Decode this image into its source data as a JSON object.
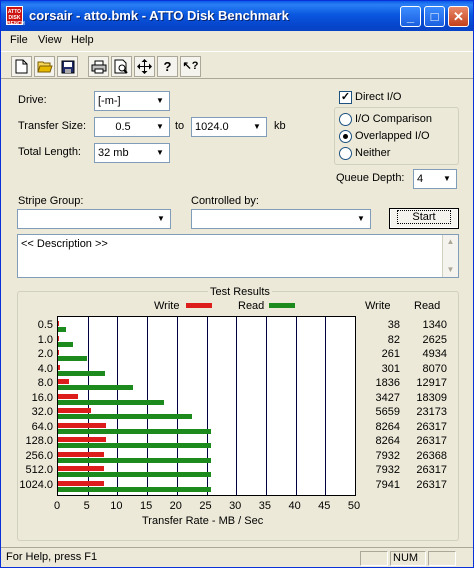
{
  "window": {
    "title": "corsair - atto.bmk - ATTO Disk Benchmark",
    "app_icon_text": "ATTO DISK BENCH"
  },
  "titlebar_buttons": {
    "minimize": "_",
    "maximize": "□",
    "close": "✕"
  },
  "menu": [
    "File",
    "View",
    "Help"
  ],
  "toolbar_icons": [
    "new-file-icon",
    "open-folder-icon",
    "save-icon",
    "print-icon",
    "print-preview-icon",
    "move-icon",
    "help-icon",
    "context-help-icon"
  ],
  "form": {
    "drive_label": "Drive:",
    "drive_value": "[-m-]",
    "transfer_size_label": "Transfer Size:",
    "transfer_from": "0.5",
    "to_label": "to",
    "transfer_to": "1024.0",
    "kb_label": "kb",
    "total_length_label": "Total Length:",
    "total_length_value": "32 mb",
    "direct_io_label": "Direct I/O",
    "direct_io_checked": true,
    "io_options": [
      {
        "label": "I/O Comparison",
        "selected": false
      },
      {
        "label": "Overlapped I/O",
        "selected": true
      },
      {
        "label": "Neither",
        "selected": false
      }
    ],
    "queue_depth_label": "Queue Depth:",
    "queue_depth_value": "4",
    "stripe_group_label": "Stripe Group:",
    "stripe_group_value": "",
    "controlled_by_label": "Controlled by:",
    "controlled_by_value": "",
    "start_label": "Start",
    "description_text": "<< Description >>"
  },
  "results": {
    "title": "Test Results",
    "write_legend": "Write",
    "read_legend": "Read",
    "write_color": "#dd1c1c",
    "read_color": "#1d8a1d",
    "col_write": "Write",
    "col_read": "Read",
    "xlabel": "Transfer Rate - MB / Sec"
  },
  "chart_data": {
    "type": "bar",
    "orientation": "horizontal",
    "title": "Test Results",
    "xlabel": "Transfer Rate - MB / Sec",
    "ylabel": "",
    "xlim": [
      0,
      50
    ],
    "xticks": [
      "0",
      "5",
      "10",
      "15",
      "20",
      "25",
      "30",
      "35",
      "40",
      "45",
      "50"
    ],
    "categories": [
      "0.5",
      "1.0",
      "2.0",
      "4.0",
      "8.0",
      "16.0",
      "32.0",
      "64.0",
      "128.0",
      "256.0",
      "512.0",
      "1024.0"
    ],
    "series": [
      {
        "name": "Write",
        "values": [
          0.04,
          0.08,
          0.25,
          0.29,
          1.79,
          3.35,
          5.53,
          8.07,
          8.07,
          7.75,
          7.75,
          7.75
        ],
        "labels": [
          "38",
          "82",
          "261",
          "301",
          "1836",
          "3427",
          "5659",
          "8264",
          "8264",
          "7932",
          "7932",
          "7941"
        ]
      },
      {
        "name": "Read",
        "values": [
          1.31,
          2.56,
          4.82,
          7.88,
          12.61,
          17.88,
          22.63,
          25.7,
          25.7,
          25.75,
          25.7,
          25.7
        ],
        "labels": [
          "1340",
          "2625",
          "4934",
          "8070",
          "12917",
          "18309",
          "23173",
          "26317",
          "26317",
          "26368",
          "26317",
          "26317"
        ]
      }
    ],
    "grid": true,
    "legend": "top"
  },
  "status": {
    "text": "For Help, press F1",
    "num": "NUM"
  }
}
